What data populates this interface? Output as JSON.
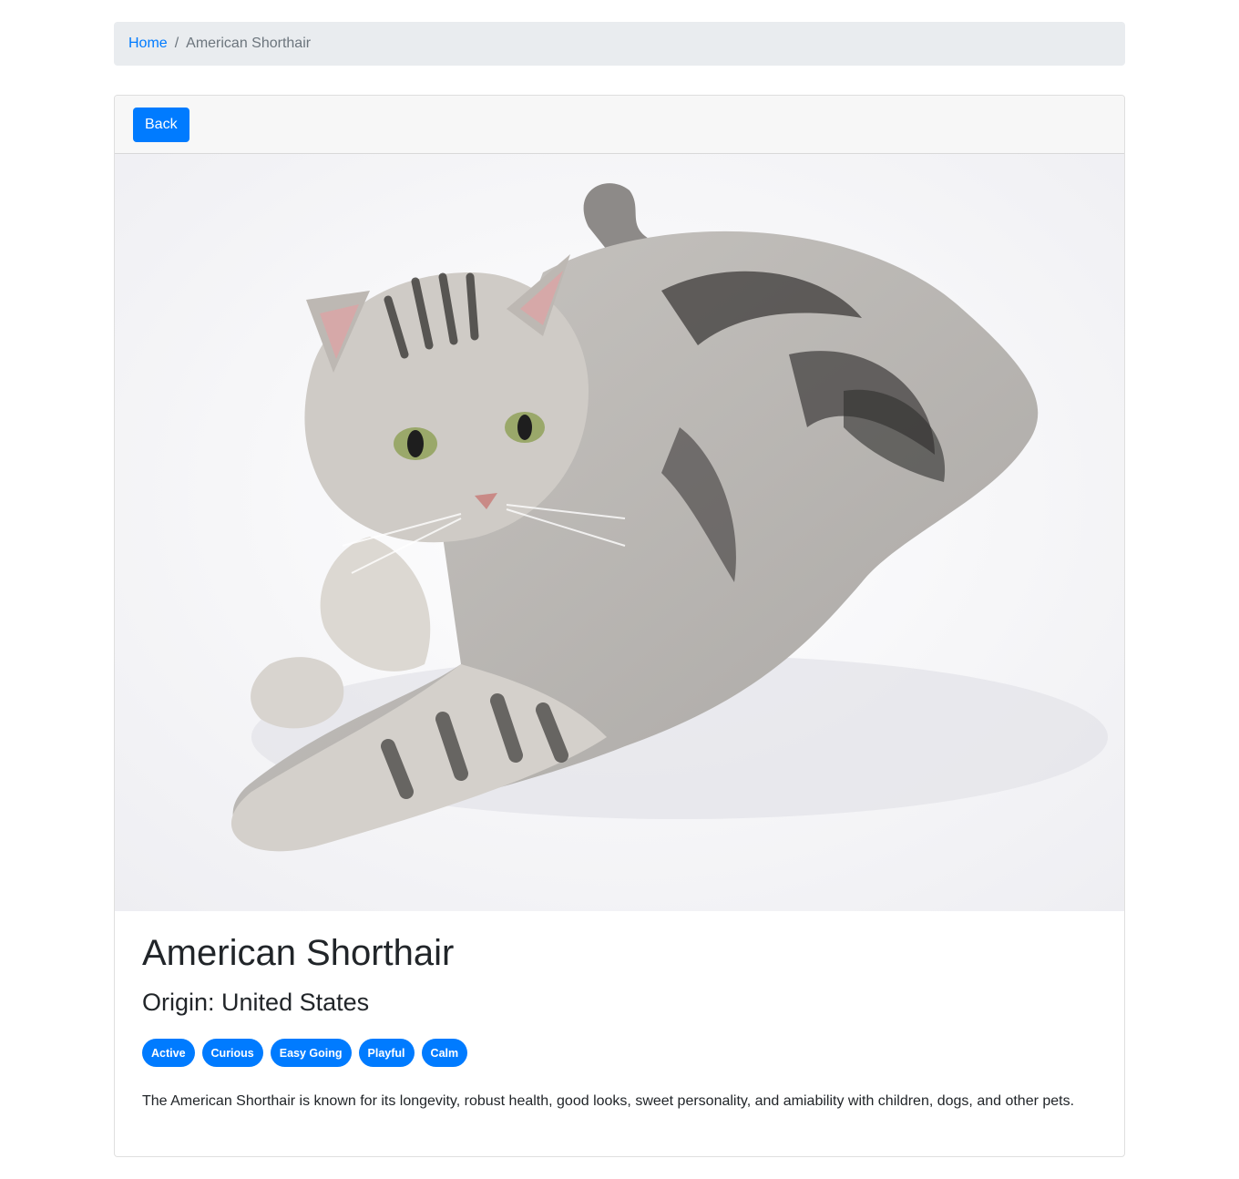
{
  "breadcrumb": {
    "home": "Home",
    "separator": "/",
    "current": "American Shorthair"
  },
  "toolbar": {
    "back_label": "Back"
  },
  "photo": {
    "subject": "silver tabby cat lying down"
  },
  "breed": {
    "name": "American Shorthair",
    "origin_label": "Origin:",
    "origin_value": "United States",
    "temperaments": [
      "Active",
      "Curious",
      "Easy Going",
      "Playful",
      "Calm"
    ],
    "description": "The American Shorthair is known for its longevity, robust health, good looks, sweet personality, and amiability with children, dogs, and other pets."
  },
  "colors": {
    "accent": "#007bff",
    "breadcrumb_bg": "#e9ecef",
    "header_bg": "#f7f7f7"
  }
}
